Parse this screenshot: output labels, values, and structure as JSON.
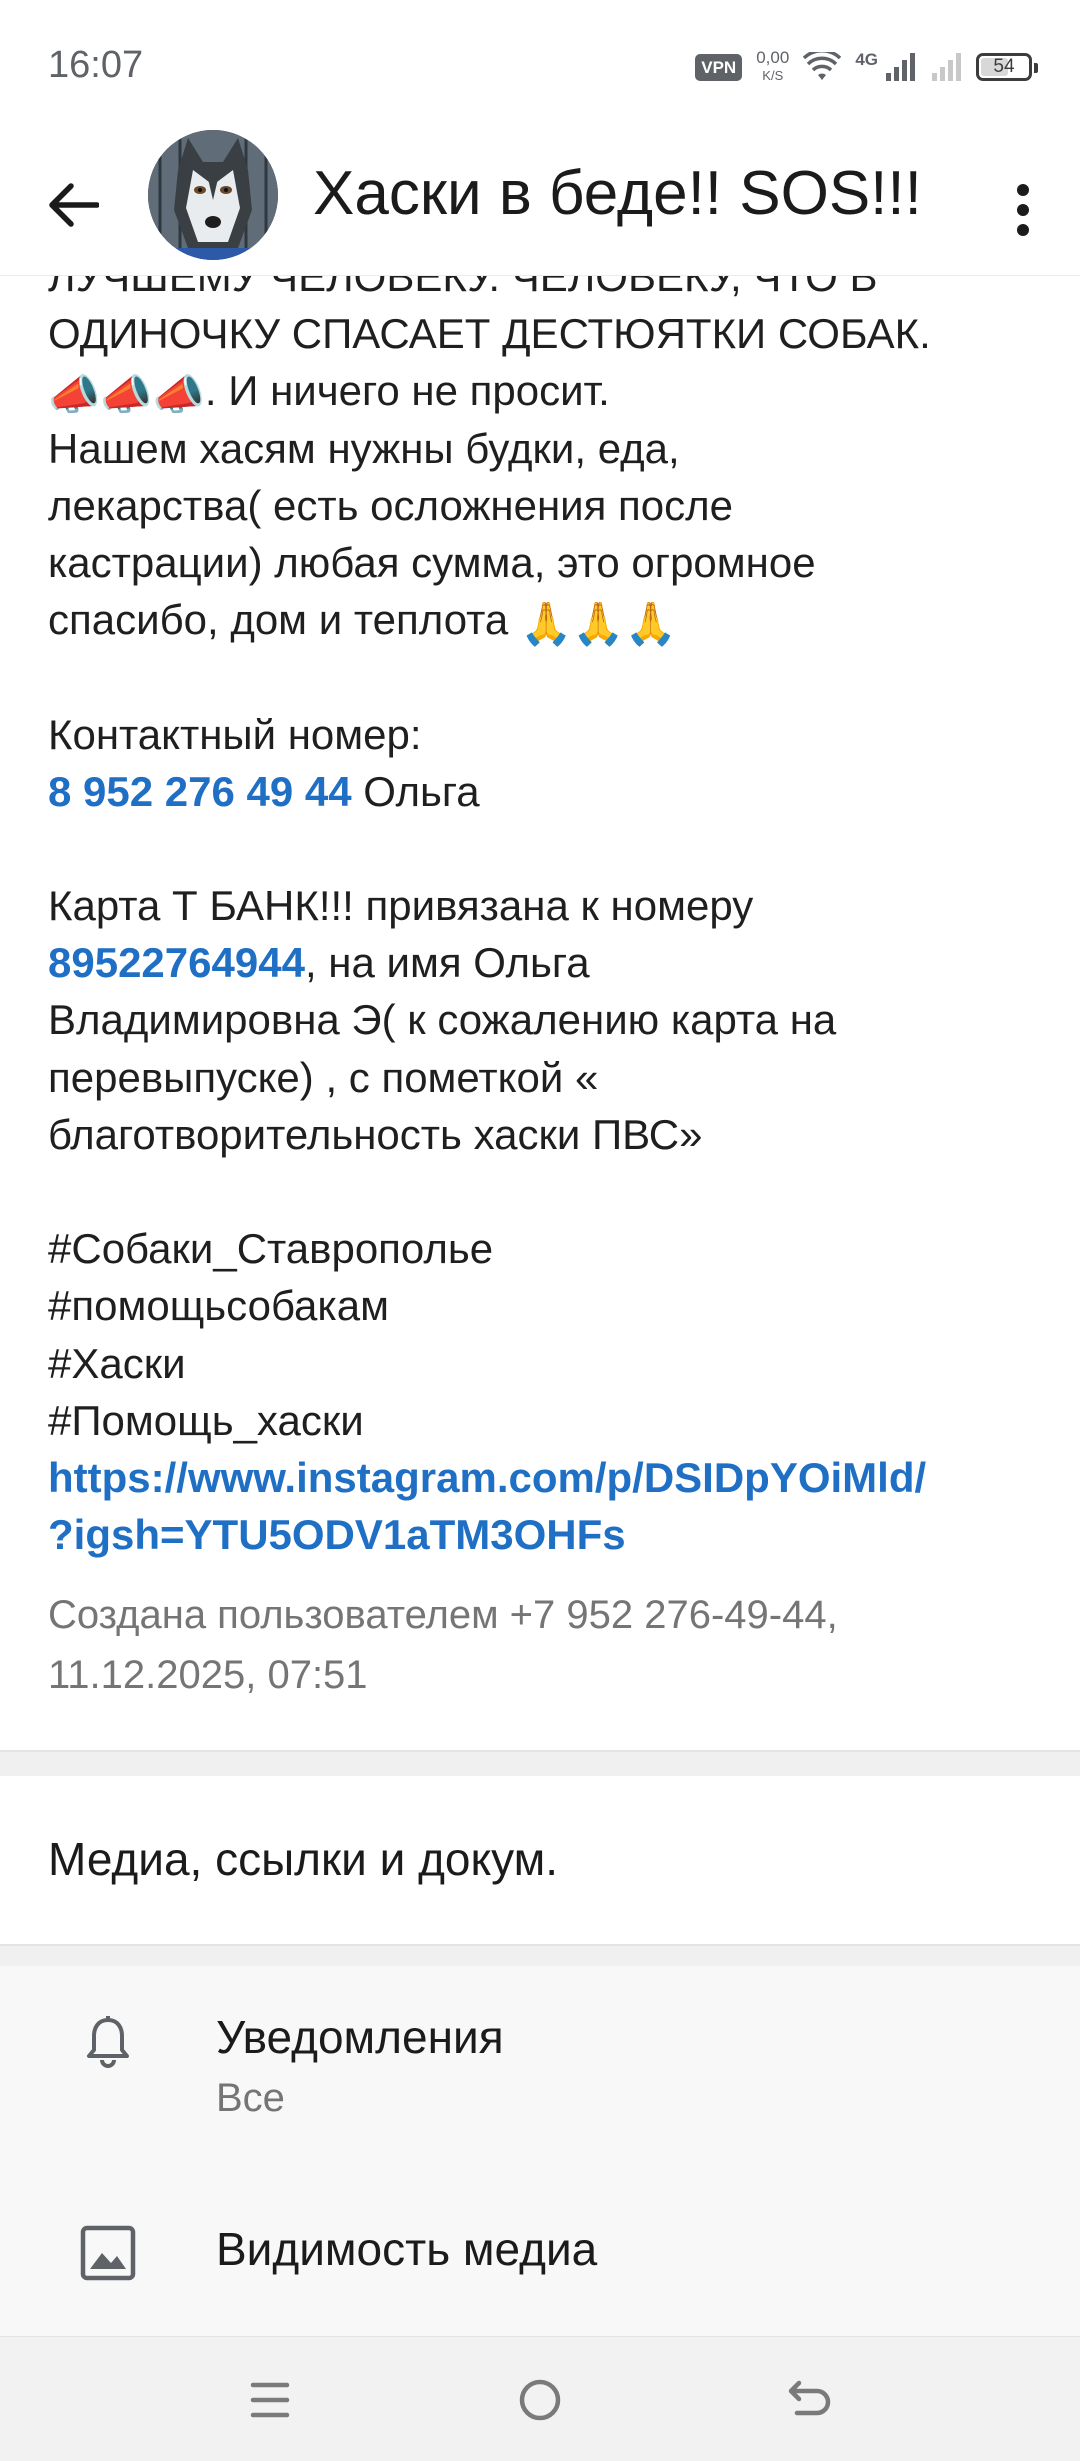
{
  "status_bar": {
    "time": "16:07",
    "vpn": "VPN",
    "speed_value": "0,00",
    "speed_unit": "K/S",
    "network": "4G",
    "battery": "54"
  },
  "header": {
    "title": "Хаски в беде!! SOS!!!"
  },
  "description": {
    "line_1": "ЛУЧШЕМУ ЧЕЛОВЕКУ.  ЧЕЛОВЕКУ, ЧТО В",
    "line_2": "ОДИНОЧКУ СПАСАЕТ ДЕСТЮЯТКИ СОБАК.",
    "line_3_emoji": "📣📣📣",
    "line_3_text": ".                 И ничего не просит.",
    "line_4": "Нашем хасям нужны будки, еда,",
    "line_5": "лекарства( есть осложнения после",
    "line_6": "кастрации) любая сумма, это огромное",
    "line_7_text": "спасибо, дом и теплота ",
    "line_7_emoji": "🙏🙏🙏",
    "contact_label": "Контактный номер:",
    "contact_phone": "8 952 276 49 44",
    "contact_name": " Ольга",
    "card_line_1": "Карта Т БАНК!!! привязана к номеру",
    "card_phone": "89522764944",
    "card_line_2_rest": ",   на имя Ольга",
    "card_line_3": "Владимировна Э( к сожалению карта на",
    "card_line_4": "перевыпуске) , с пометкой «",
    "card_line_5": "благотворительность хаски ПВС»",
    "hashtag_1": "#Собаки_Ставрополье",
    "hashtag_2": "#помощьсобакам",
    "hashtag_3": "#Хаски",
    "hashtag_4": "#Помощь_хаски",
    "url_line_1": "https://www.instagram.com/p/DSIDpYOiMld/",
    "url_line_2": "?igsh=YTU5ODV1aTM3OHFs"
  },
  "created_info": {
    "line_1": "Создана пользователем +7 952 276-49-44,",
    "line_2": "11.12.2025, 07:51"
  },
  "media": {
    "label": "Медиа, ссылки и докум."
  },
  "settings": {
    "notifications_title": "Уведомления",
    "notifications_value": "Все",
    "media_visibility_title": "Видимость медиа"
  },
  "icons": {
    "back": "arrow-left",
    "more": "more-vertical",
    "bell": "bell",
    "image": "image",
    "nav_menu": "menu",
    "nav_home": "home-circle",
    "nav_back": "back-arrow"
  },
  "colors": {
    "link": "#1f6fc5",
    "secondary_text": "#757575",
    "divider": "#f0f0f0"
  }
}
